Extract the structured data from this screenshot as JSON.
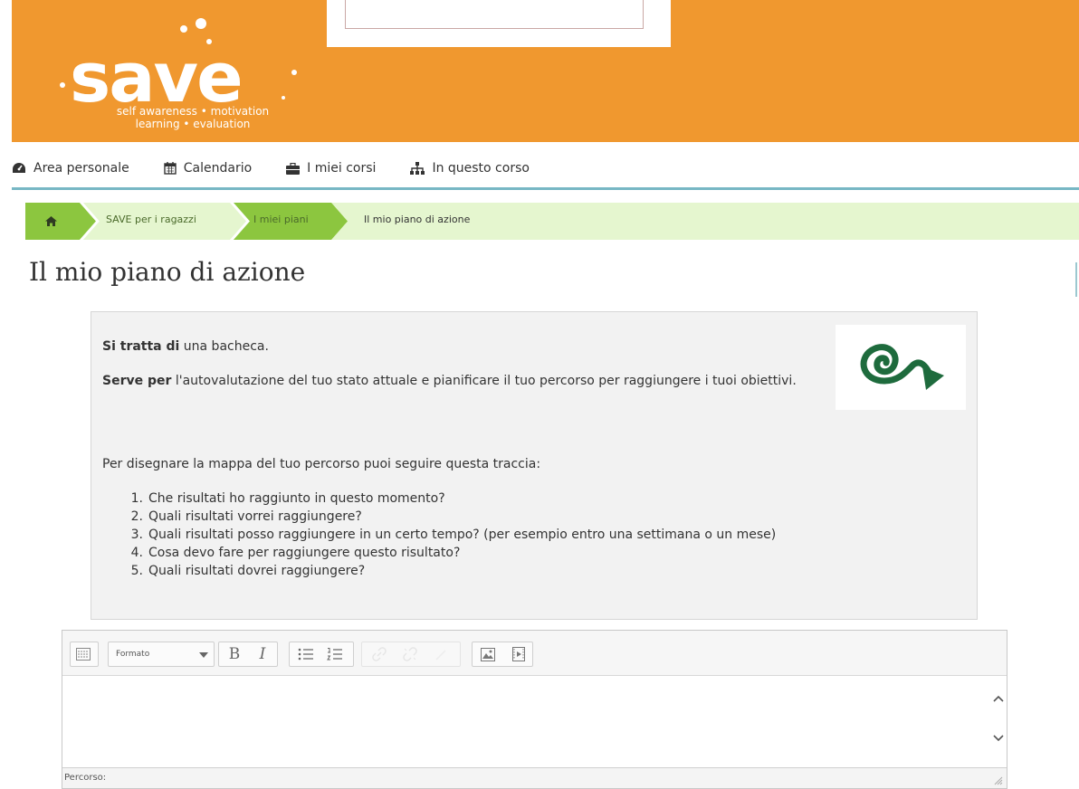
{
  "colors": {
    "header_bg": "#f0982f",
    "nav_line": "#77b7c4",
    "breadcrumb_bg": "#e5f6cf",
    "breadcrumb_active": "#8cc63f",
    "spiral": "#1e6b3d"
  },
  "logo": {
    "wordmark": "save",
    "tagline_line1": "self awareness • motivation",
    "tagline_line2": "learning • evaluation"
  },
  "nav": {
    "items": [
      {
        "label": "Area personale",
        "icon": "dashboard-icon"
      },
      {
        "label": "Calendario",
        "icon": "calendar-icon"
      },
      {
        "label": "I miei corsi",
        "icon": "briefcase-icon"
      },
      {
        "label": "In questo corso",
        "icon": "sitemap-icon"
      }
    ]
  },
  "breadcrumb": {
    "home_icon": "home-icon",
    "items": [
      "SAVE per i ragazzi",
      "I miei piani",
      "Il mio piano di azione"
    ]
  },
  "page": {
    "title": "Il mio piano di azione"
  },
  "info": {
    "p1_bold": "Si tratta di",
    "p1_rest": " una bacheca.",
    "p2_bold": "Serve per",
    "p2_rest": " l'autovalutazione del tuo stato attuale e pianificare il tuo percorso per raggiungere i tuoi obiettivi.",
    "p3": "Per disegnare la mappa del tuo percorso puoi seguire questa traccia:",
    "list": [
      {
        "n": "1.",
        "text": "Che risultati ho raggiunto in questo momento?"
      },
      {
        "n": "2.",
        "text": "Quali risultati vorrei raggiungere?"
      },
      {
        "n": "3.",
        "text": "Quali risultati posso raggiungere in un certo tempo? (per esempio entro una settimana o un mese)"
      },
      {
        "n": "4.",
        "text": "Cosa devo fare per raggiungere questo risultato?"
      },
      {
        "n": "5.",
        "text": "Quali risultati dovrei raggiungere?"
      }
    ],
    "image_icon": "spiral-arrow-icon"
  },
  "editor": {
    "format_label": "Formato",
    "bold_label": "B",
    "italic_label": "I",
    "status_label": "Percorso:"
  }
}
